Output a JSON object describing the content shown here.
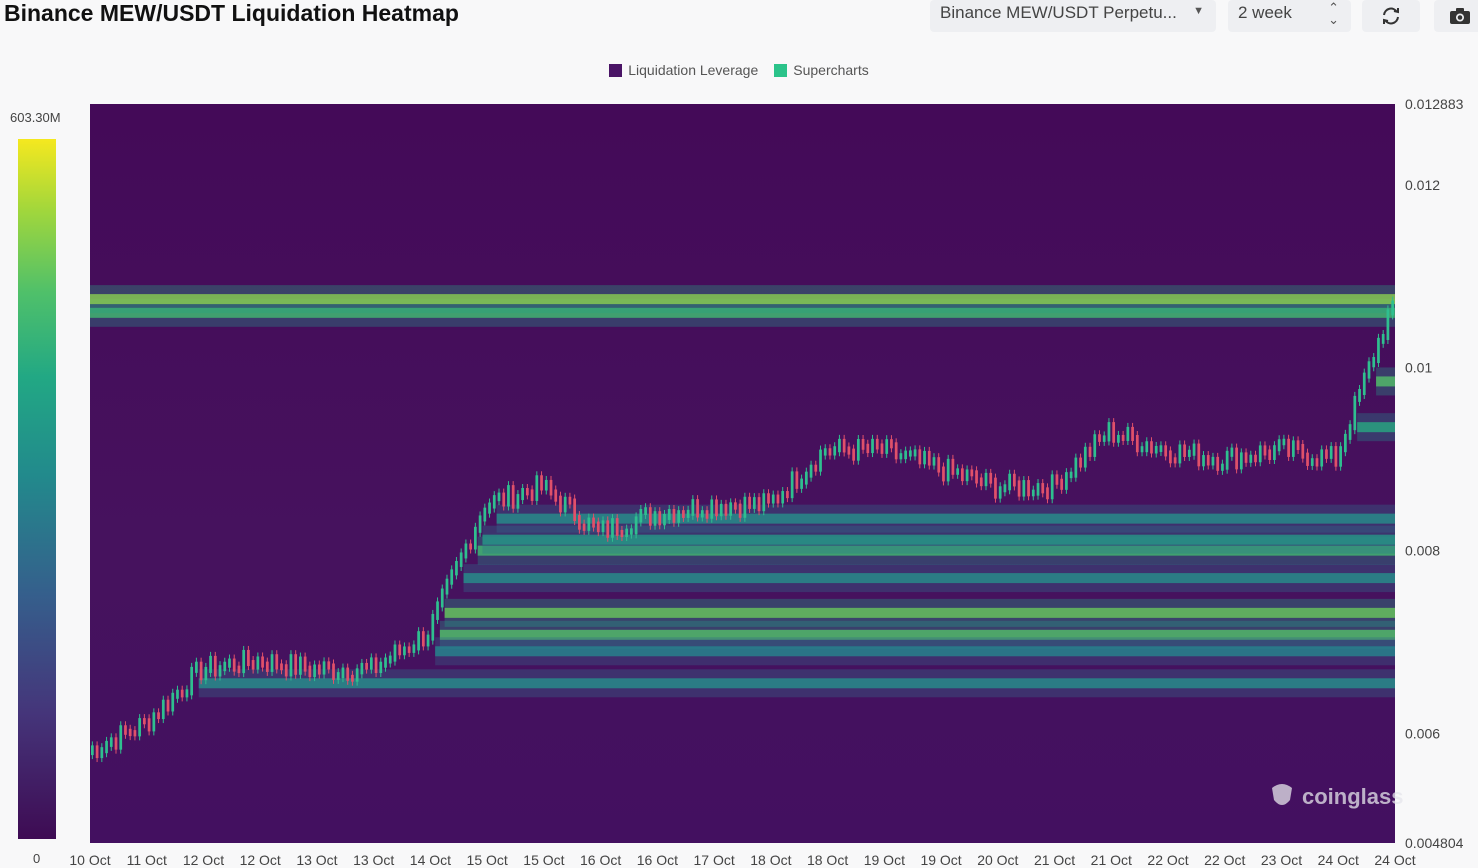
{
  "header": {
    "title": "Binance MEW/USDT Liquidation Heatmap",
    "pair_select": "Binance MEW/USDT Perpetu...",
    "range_select": "2 week"
  },
  "legend": [
    {
      "label": "Liquidation Leverage",
      "color": "#4a1466"
    },
    {
      "label": "Supercharts",
      "color": "#2bc38a"
    }
  ],
  "colorscale": {
    "max_label": "603.30M",
    "min_label": "0"
  },
  "watermark": "coinglass",
  "chart_data": {
    "type": "heatmap",
    "title": "Binance MEW/USDT Liquidation Heatmap",
    "y_tick_labels": [
      "0.012883",
      "0.012",
      "0.01",
      "0.008",
      "0.006",
      "0.004804"
    ],
    "y_ticks": [
      0.012883,
      0.012,
      0.01,
      0.008,
      0.006,
      0.004804
    ],
    "ylim": [
      0.004804,
      0.012883
    ],
    "x_tick_labels": [
      "10 Oct",
      "11 Oct",
      "12 Oct",
      "12 Oct",
      "13 Oct",
      "13 Oct",
      "14 Oct",
      "15 Oct",
      "15 Oct",
      "16 Oct",
      "16 Oct",
      "17 Oct",
      "18 Oct",
      "18 Oct",
      "19 Oct",
      "19 Oct",
      "20 Oct",
      "21 Oct",
      "21 Oct",
      "22 Oct",
      "22 Oct",
      "23 Oct",
      "24 Oct",
      "24 Oct"
    ],
    "price_series": {
      "name": "Supercharts",
      "x": [
        "10 Oct",
        "11 Oct",
        "12 Oct",
        "12 Oct",
        "13 Oct",
        "13 Oct",
        "14 Oct",
        "15 Oct",
        "15 Oct",
        "16 Oct",
        "16 Oct",
        "17 Oct",
        "18 Oct",
        "18 Oct",
        "19 Oct",
        "19 Oct",
        "20 Oct",
        "21 Oct",
        "21 Oct",
        "22 Oct",
        "22 Oct",
        "23 Oct",
        "24 Oct",
        "24 Oct"
      ],
      "y": [
        0.0058,
        0.0061,
        0.0067,
        0.0068,
        0.0067,
        0.0067,
        0.0071,
        0.0085,
        0.0087,
        0.0082,
        0.0084,
        0.0085,
        0.0085,
        0.0091,
        0.0091,
        0.0089,
        0.0087,
        0.0087,
        0.0093,
        0.0091,
        0.009,
        0.0091,
        0.009,
        0.0107
      ]
    },
    "liquidation_bands": [
      {
        "price": 0.00708,
        "intensity": 0.85
      },
      {
        "price": 0.00732,
        "intensity": 0.9
      },
      {
        "price": 0.0077,
        "intensity": 0.55
      },
      {
        "price": 0.008,
        "intensity": 0.8
      },
      {
        "price": 0.00812,
        "intensity": 0.6
      },
      {
        "price": 0.00835,
        "intensity": 0.55
      },
      {
        "price": 0.00985,
        "intensity": 0.85
      },
      {
        "price": 0.00935,
        "intensity": 0.7
      },
      {
        "price": 0.0106,
        "intensity": 0.8
      },
      {
        "price": 0.01075,
        "intensity": 0.95
      },
      {
        "price": 0.00655,
        "intensity": 0.55
      },
      {
        "price": 0.0069,
        "intensity": 0.5
      }
    ],
    "grid": false,
    "legend_position": "top-center"
  }
}
